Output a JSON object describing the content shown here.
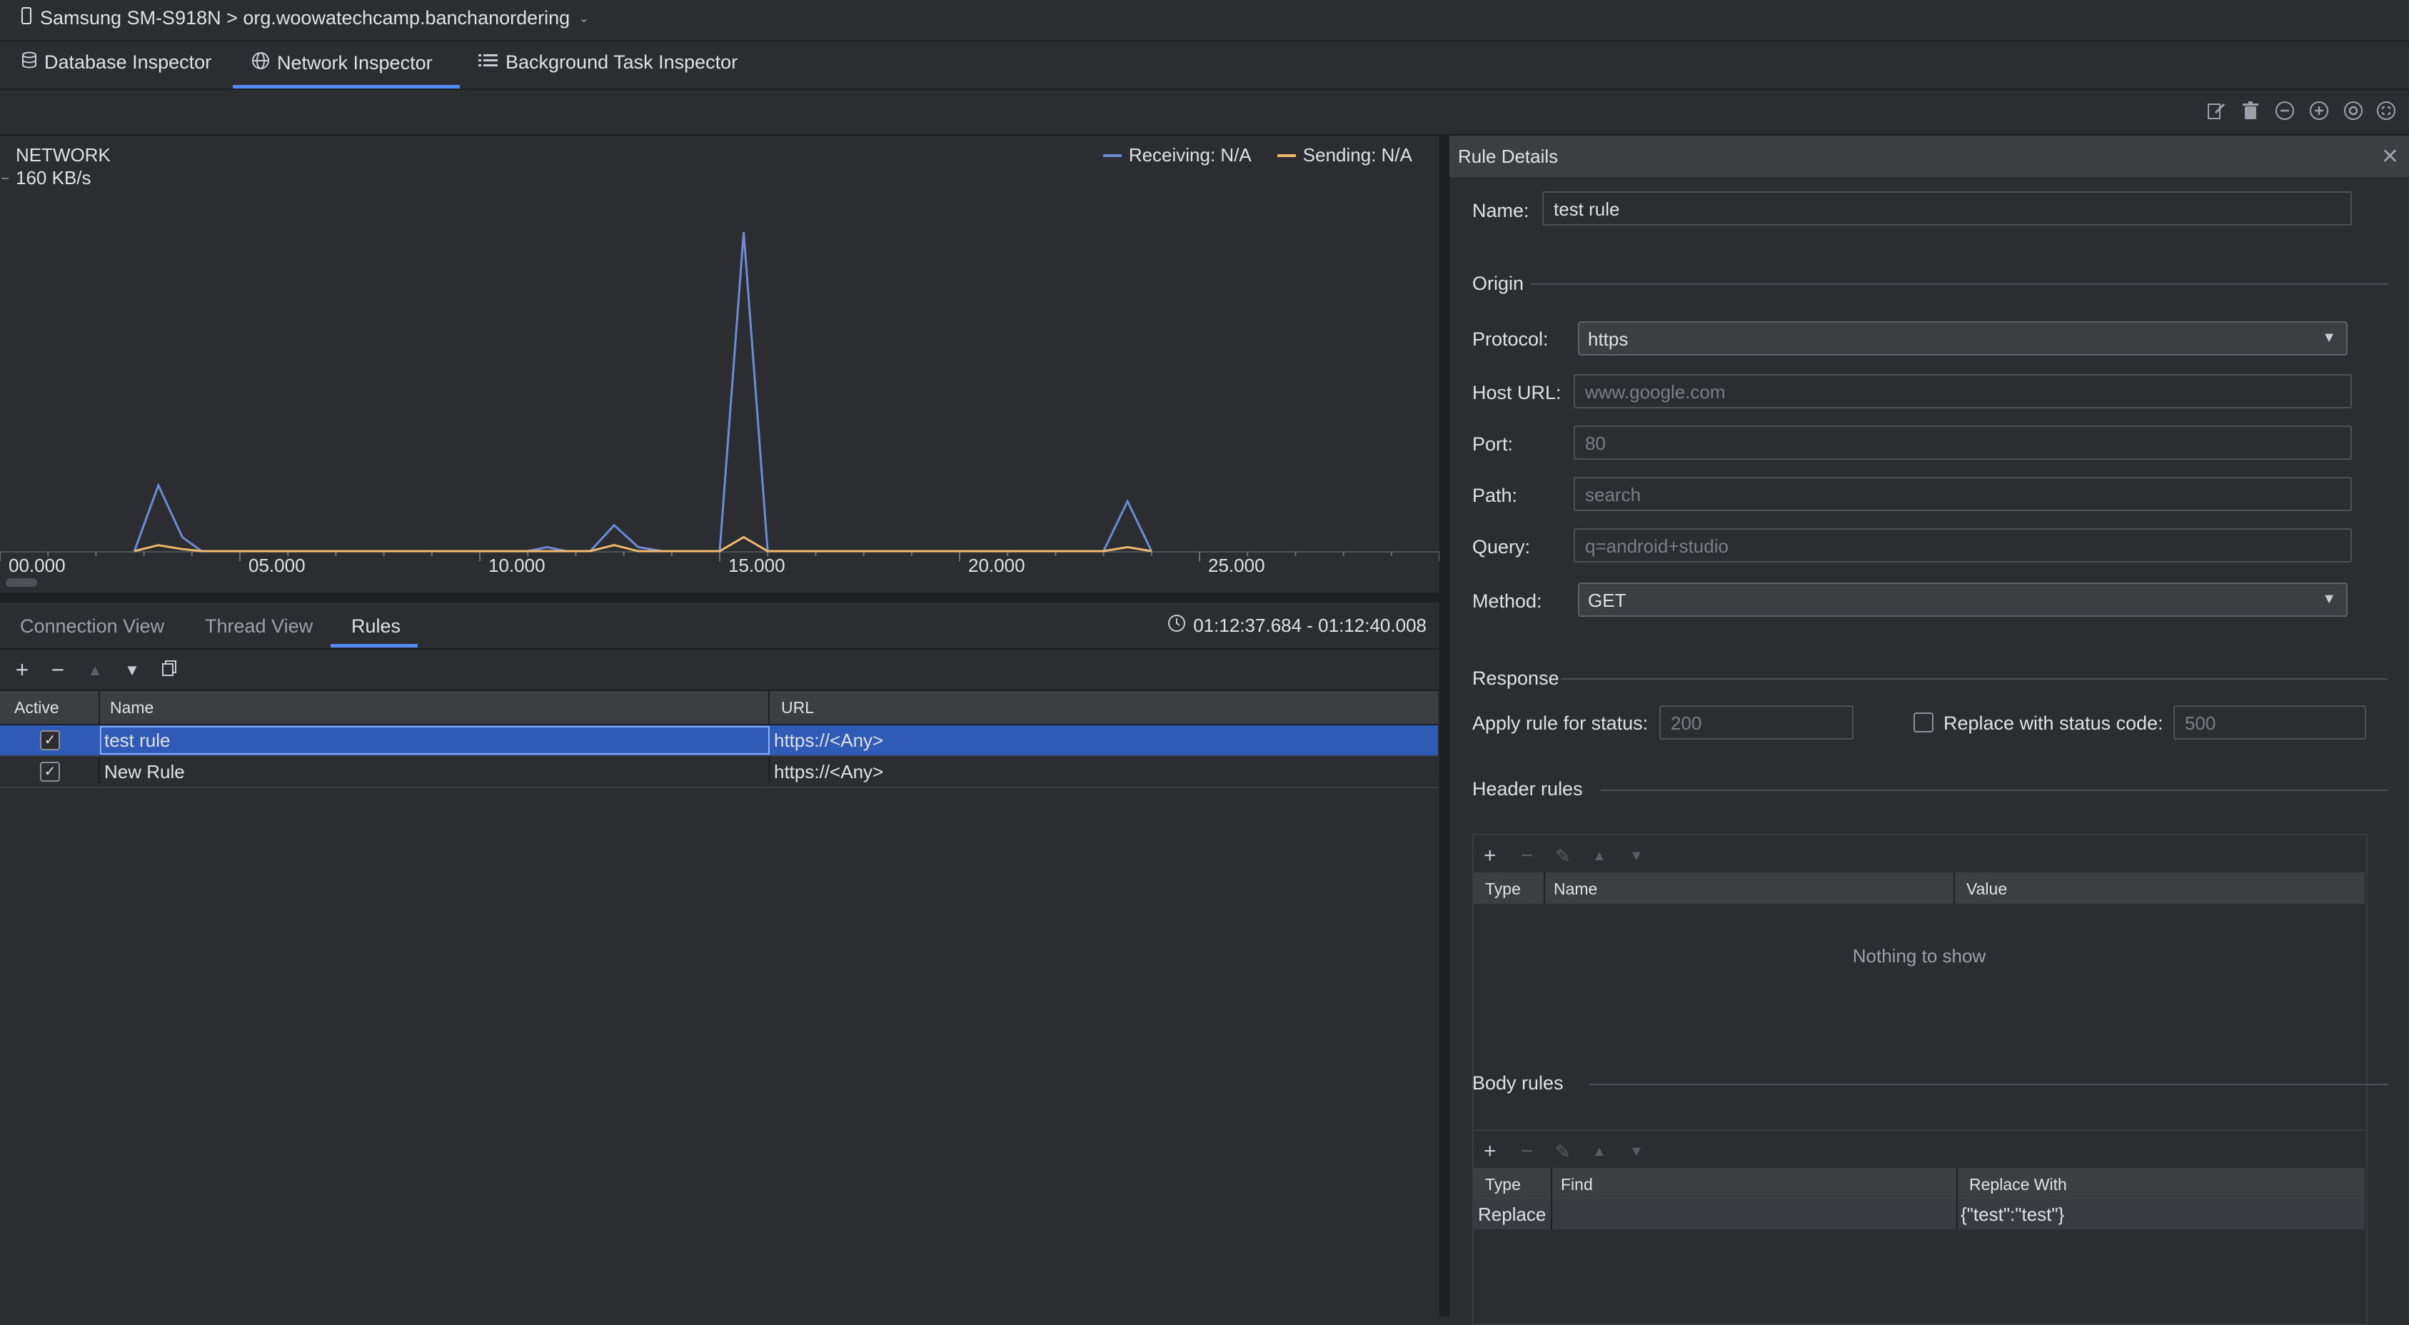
{
  "device": {
    "label": "Samsung SM-S918N > org.woowatechcamp.banchanordering",
    "icon": "phone-icon",
    "dropdown_icon": "chevron-down-icon"
  },
  "inspector_tabs": [
    {
      "label": "Database Inspector",
      "icon": "database-icon"
    },
    {
      "label": "Network Inspector",
      "icon": "globe-icon",
      "active": true
    },
    {
      "label": "Background Task Inspector",
      "icon": "list-icon"
    }
  ],
  "chart": {
    "title": "NETWORK",
    "ymax_label": "160 KB/s",
    "legend": [
      {
        "label": "Receiving: N/A",
        "color": "#6b8bd6"
      },
      {
        "label": "Sending: N/A",
        "color": "#f0b86a"
      }
    ]
  },
  "chart_data": {
    "type": "line",
    "title": "NETWORK",
    "ylabel": "160 KB/s",
    "xlabel": "",
    "x_ticks": [
      "00.000",
      "05.000",
      "10.000",
      "15.000",
      "20.000",
      "25.000"
    ],
    "xlim": [
      0,
      30
    ],
    "ylim": [
      0,
      160
    ],
    "series": [
      {
        "name": "Receiving: N/A",
        "color": "#6b8bd6",
        "points": [
          [
            2.8,
            0
          ],
          [
            3.3,
            33
          ],
          [
            3.8,
            7
          ],
          [
            4.2,
            0
          ],
          [
            11.0,
            0
          ],
          [
            11.4,
            2
          ],
          [
            11.8,
            0
          ],
          [
            12.3,
            0
          ],
          [
            12.8,
            13
          ],
          [
            13.3,
            2
          ],
          [
            13.8,
            0
          ],
          [
            15.0,
            0
          ],
          [
            15.5,
            160
          ],
          [
            16.0,
            0
          ],
          [
            23.0,
            0
          ],
          [
            23.5,
            25
          ],
          [
            24.0,
            0
          ]
        ]
      },
      {
        "name": "Sending: N/A",
        "color": "#f0b86a",
        "points": [
          [
            2.8,
            0
          ],
          [
            3.3,
            3
          ],
          [
            3.8,
            1
          ],
          [
            4.2,
            0
          ],
          [
            12.3,
            0
          ],
          [
            12.8,
            3
          ],
          [
            13.3,
            0
          ],
          [
            15.0,
            0
          ],
          [
            15.5,
            7
          ],
          [
            16.0,
            0
          ],
          [
            23.0,
            0
          ],
          [
            23.5,
            2
          ],
          [
            24.0,
            0
          ]
        ]
      }
    ]
  },
  "lower_tabs": [
    {
      "label": "Connection View"
    },
    {
      "label": "Thread View"
    },
    {
      "label": "Rules",
      "active": true
    }
  ],
  "time_range": "01:12:37.684 - 01:12:40.008",
  "rules_table": {
    "columns": [
      "Active",
      "Name",
      "URL"
    ],
    "rows": [
      {
        "active": true,
        "name": "test rule",
        "url": "https://<Any>",
        "selected": true
      },
      {
        "active": true,
        "name": "New Rule",
        "url": "https://<Any>",
        "selected": false
      }
    ]
  },
  "rule_details": {
    "title": "Rule Details",
    "name_label": "Name:",
    "name_value": "test rule",
    "origin_label": "Origin",
    "protocol_label": "Protocol:",
    "protocol_value": "https",
    "host_label": "Host URL:",
    "host_placeholder": "www.google.com",
    "port_label": "Port:",
    "port_placeholder": "80",
    "path_label": "Path:",
    "path_placeholder": "search",
    "query_label": "Query:",
    "query_placeholder": "q=android+studio",
    "method_label": "Method:",
    "method_value": "GET",
    "response_label": "Response",
    "apply_status_label": "Apply rule for status:",
    "apply_status_placeholder": "200",
    "replace_status_label": "Replace with status code:",
    "replace_status_placeholder": "500",
    "header_rules_label": "Header rules",
    "header_columns": [
      "Type",
      "Name",
      "Value"
    ],
    "header_empty": "Nothing to show",
    "body_rules_label": "Body rules",
    "body_columns": [
      "Type",
      "Find",
      "Replace With"
    ],
    "body_rows": [
      {
        "type": "Replace",
        "find": "",
        "replace_with": "{\"test\":\"test\"}"
      }
    ]
  }
}
